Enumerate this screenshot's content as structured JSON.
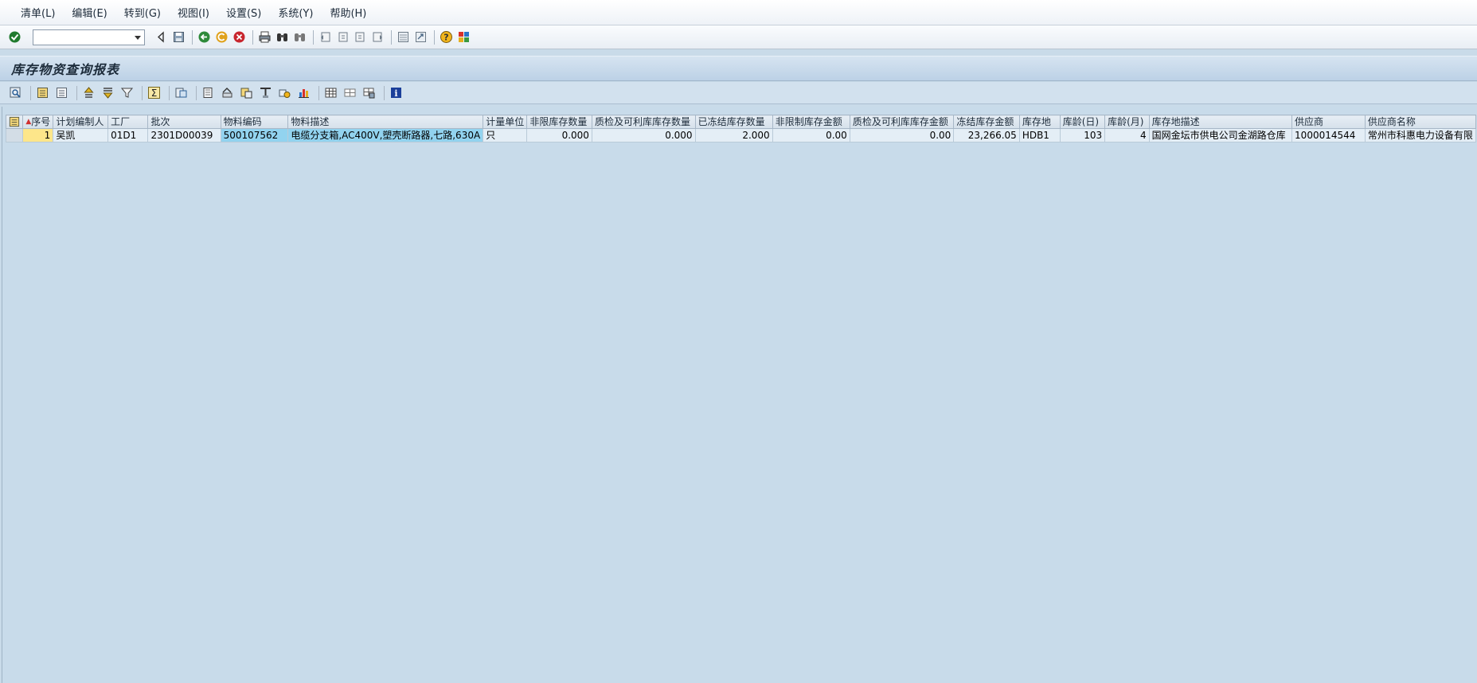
{
  "menu": [
    "清单(L)",
    "编辑(E)",
    "转到(G)",
    "视图(I)",
    "设置(S)",
    "系统(Y)",
    "帮助(H)"
  ],
  "command_field": {
    "value": "",
    "placeholder": ""
  },
  "title": "库存物资查询报表",
  "colors": {
    "seq_cell": "#fde68a",
    "highlight_cell": "#92d3ef",
    "background": "#c8dbea"
  },
  "table": {
    "headers": [
      "序号",
      "计划编制人",
      "工厂",
      "批次",
      "物料编码",
      "物料描述",
      "计量单位",
      "非限库存数量",
      "质检及可利库库存数量",
      "已冻结库存数量",
      "非限制库存金额",
      "质检及可利库库存金额",
      "冻结库存金额",
      "库存地",
      "库龄(日)",
      "库龄(月)",
      "库存地描述",
      "供应商",
      "供应商名称"
    ],
    "rows": [
      [
        "1",
        "吴凯",
        "01D1",
        "2301D00039",
        "500107562",
        "电缆分支箱,AC400V,塑壳断路器,七路,630A",
        "只",
        "0.000",
        "0.000",
        "2.000",
        "0.00",
        "0.00",
        "23,266.05",
        "HDB1",
        "103",
        "4",
        "国网金坛市供电公司金湖路仓库",
        "1000014544",
        "常州市科惠电力设备有限"
      ]
    ]
  }
}
